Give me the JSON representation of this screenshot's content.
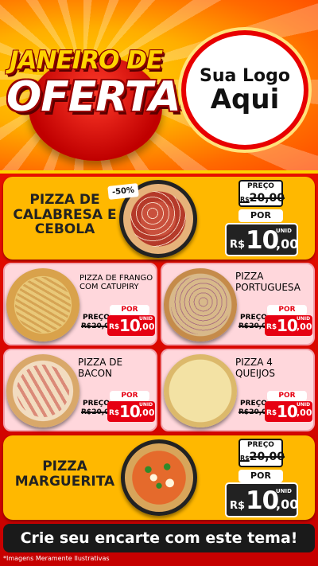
{
  "header": {
    "title_line1": "JANEIRO DE",
    "title_line2": "OFERTAS",
    "logo_line1": "Sua Logo",
    "logo_line2": "Aqui"
  },
  "featured": [
    {
      "name": "PIZZA DE CALABRESA E CEBOLA",
      "discount": "-50%",
      "old_label": "PREÇO",
      "old_currency": "R$",
      "old_price": "20,00",
      "por_label": "POR",
      "currency": "R$",
      "price_int": "10",
      "price_cents": ",00",
      "unit": "UNID"
    },
    {
      "name": "PIZZA MARGUERITA",
      "old_label": "PREÇO",
      "old_currency": "R$",
      "old_price": "20,00",
      "por_label": "POR",
      "currency": "R$",
      "price_int": "10",
      "price_cents": ",00",
      "unit": "UNID"
    }
  ],
  "grid": [
    {
      "name": "PIZZA DE FRANGO COM CATUPIRY",
      "old_label": "PREÇO",
      "old_price": "R$20,00",
      "por_label": "POR",
      "currency": "R$",
      "price_int": "10",
      "price_cents": ",00",
      "unit": "UNID"
    },
    {
      "name": "PIZZA PORTUGUESA",
      "old_label": "PREÇO",
      "old_price": "R$20,00",
      "por_label": "POR",
      "currency": "R$",
      "price_int": "10",
      "price_cents": ",00",
      "unit": "UNID"
    },
    {
      "name": "PIZZA DE BACON",
      "old_label": "PREÇO",
      "old_price": "R$20,00",
      "por_label": "POR",
      "currency": "R$",
      "price_int": "10",
      "price_cents": ",00",
      "unit": "UNID"
    },
    {
      "name": "PIZZA 4 QUEIJOS",
      "old_label": "PREÇO",
      "old_price": "R$20,00",
      "por_label": "POR",
      "currency": "R$",
      "price_int": "10",
      "price_cents": ",00",
      "unit": "UNID"
    }
  ],
  "cta": "Crie seu encarte com este tema!",
  "disclaimer": "*Imagens Meramente Ilustrativas",
  "colors": {
    "accent_red": "#e60012",
    "card_yellow": "#ffb800",
    "card_pink": "#ffd7dc",
    "dark": "#222222"
  }
}
